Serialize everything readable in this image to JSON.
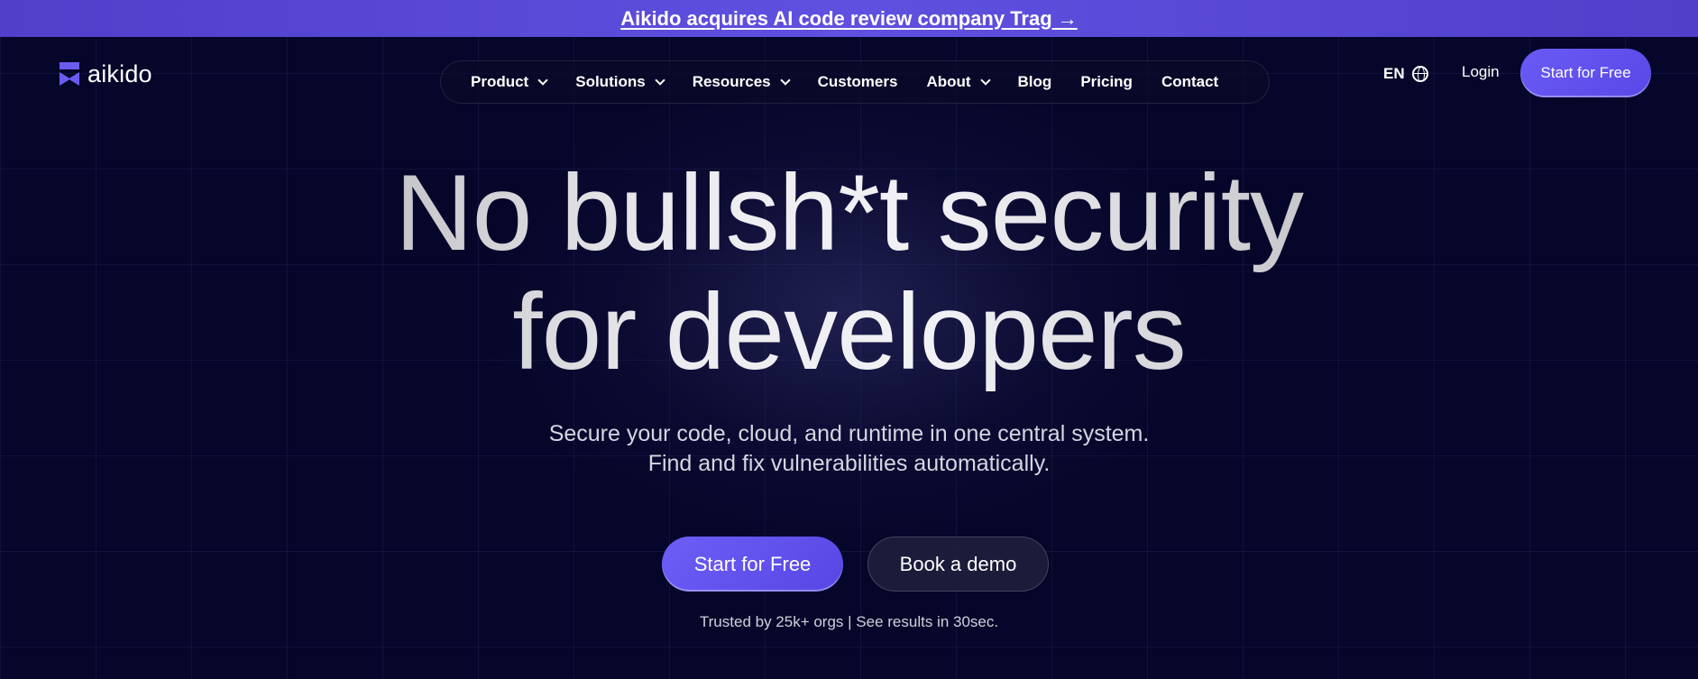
{
  "announcement": {
    "text": "Aikido acquires AI code review company Trag →"
  },
  "header": {
    "logo_text": "aikido",
    "logo_icon": "aikido-logo-icon",
    "nav": [
      {
        "label": "Product",
        "dropdown": true
      },
      {
        "label": "Solutions",
        "dropdown": true
      },
      {
        "label": "Resources",
        "dropdown": true
      },
      {
        "label": "Customers",
        "dropdown": false
      },
      {
        "label": "About",
        "dropdown": true
      },
      {
        "label": "Blog",
        "dropdown": false
      },
      {
        "label": "Pricing",
        "dropdown": false
      },
      {
        "label": "Contact",
        "dropdown": false
      }
    ],
    "language": "EN",
    "language_icon": "globe-icon",
    "login_label": "Login",
    "cta_label": "Start for Free"
  },
  "hero": {
    "headline_line1": "No bullsh*t security",
    "headline_line2": "for developers",
    "sub_line1": "Secure your code, cloud, and runtime in one central system.",
    "sub_line2": "Find and fix vulnerabilities automatically.",
    "primary_cta": "Start for Free",
    "secondary_cta": "Book a demo",
    "trust_text": "Trusted by 25k+ orgs | See results in 30sec."
  },
  "colors": {
    "background": "#06062a",
    "accent": "#6a5af5",
    "announcement_bar": "#5647d6"
  }
}
